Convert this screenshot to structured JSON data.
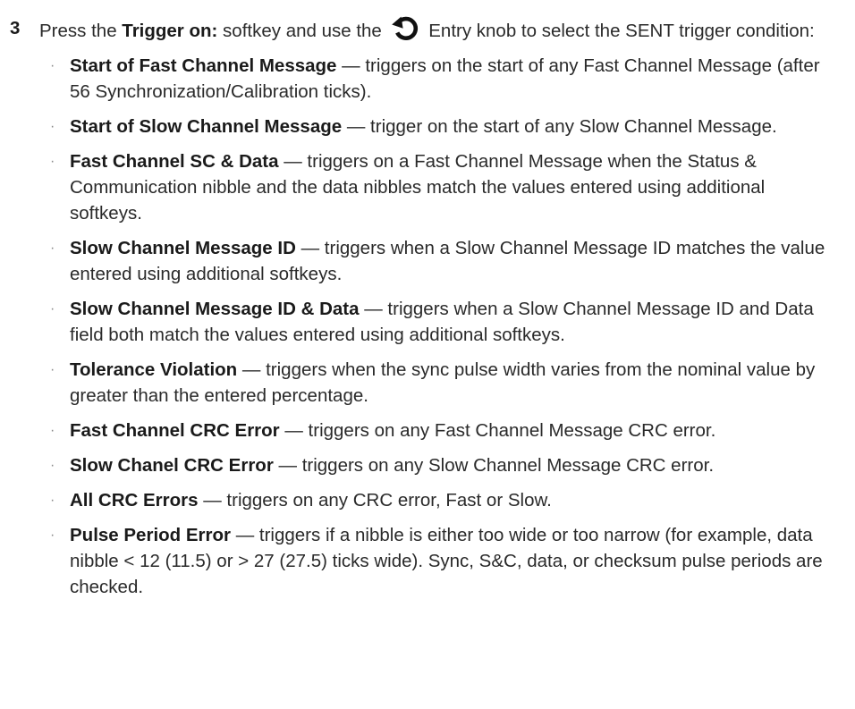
{
  "step": {
    "number": "3",
    "intro_prefix": "Press the ",
    "intro_key": "Trigger on:",
    "intro_mid": " softkey and use the ",
    "intro_suffix": " Entry knob to select the SENT trigger condition:",
    "knob_icon": "entry-knob-icon"
  },
  "bullet_glyph": "·",
  "options": [
    {
      "term": "Start of Fast Channel Message",
      "description": " — triggers on the start of any Fast Channel Message (after 56 Synchronization/Calibration ticks)."
    },
    {
      "term": "Start of Slow Channel Message",
      "description": " — trigger on the start of any Slow Channel Message."
    },
    {
      "term": "Fast Channel SC & Data",
      "description": " — triggers on a Fast Channel Message when the Status & Communication nibble and the data nibbles match the values entered using additional softkeys."
    },
    {
      "term": "Slow Channel Message ID",
      "description": " — triggers when a Slow Channel Message ID matches the value entered using additional softkeys."
    },
    {
      "term": "Slow Channel Message ID & Data",
      "description": " — triggers when a Slow Channel Message ID and Data field both match the values entered using additional softkeys."
    },
    {
      "term": "Tolerance Violation",
      "description": " — triggers when the sync pulse width varies from the nominal value by greater than the entered percentage."
    },
    {
      "term": "Fast Channel CRC Error",
      "description": " — triggers on any Fast Channel Message CRC error."
    },
    {
      "term": "Slow Chanel CRC Error",
      "description": " — triggers on any Slow Channel Message CRC error."
    },
    {
      "term": "All CRC Errors",
      "description": " — triggers on any CRC error, Fast or Slow."
    },
    {
      "term": "Pulse Period Error",
      "description": " — triggers if a nibble is either too wide or too narrow (for example, data nibble < 12 (11.5) or > 27 (27.5) ticks wide). Sync, S&C, data, or checksum pulse periods are checked."
    }
  ]
}
